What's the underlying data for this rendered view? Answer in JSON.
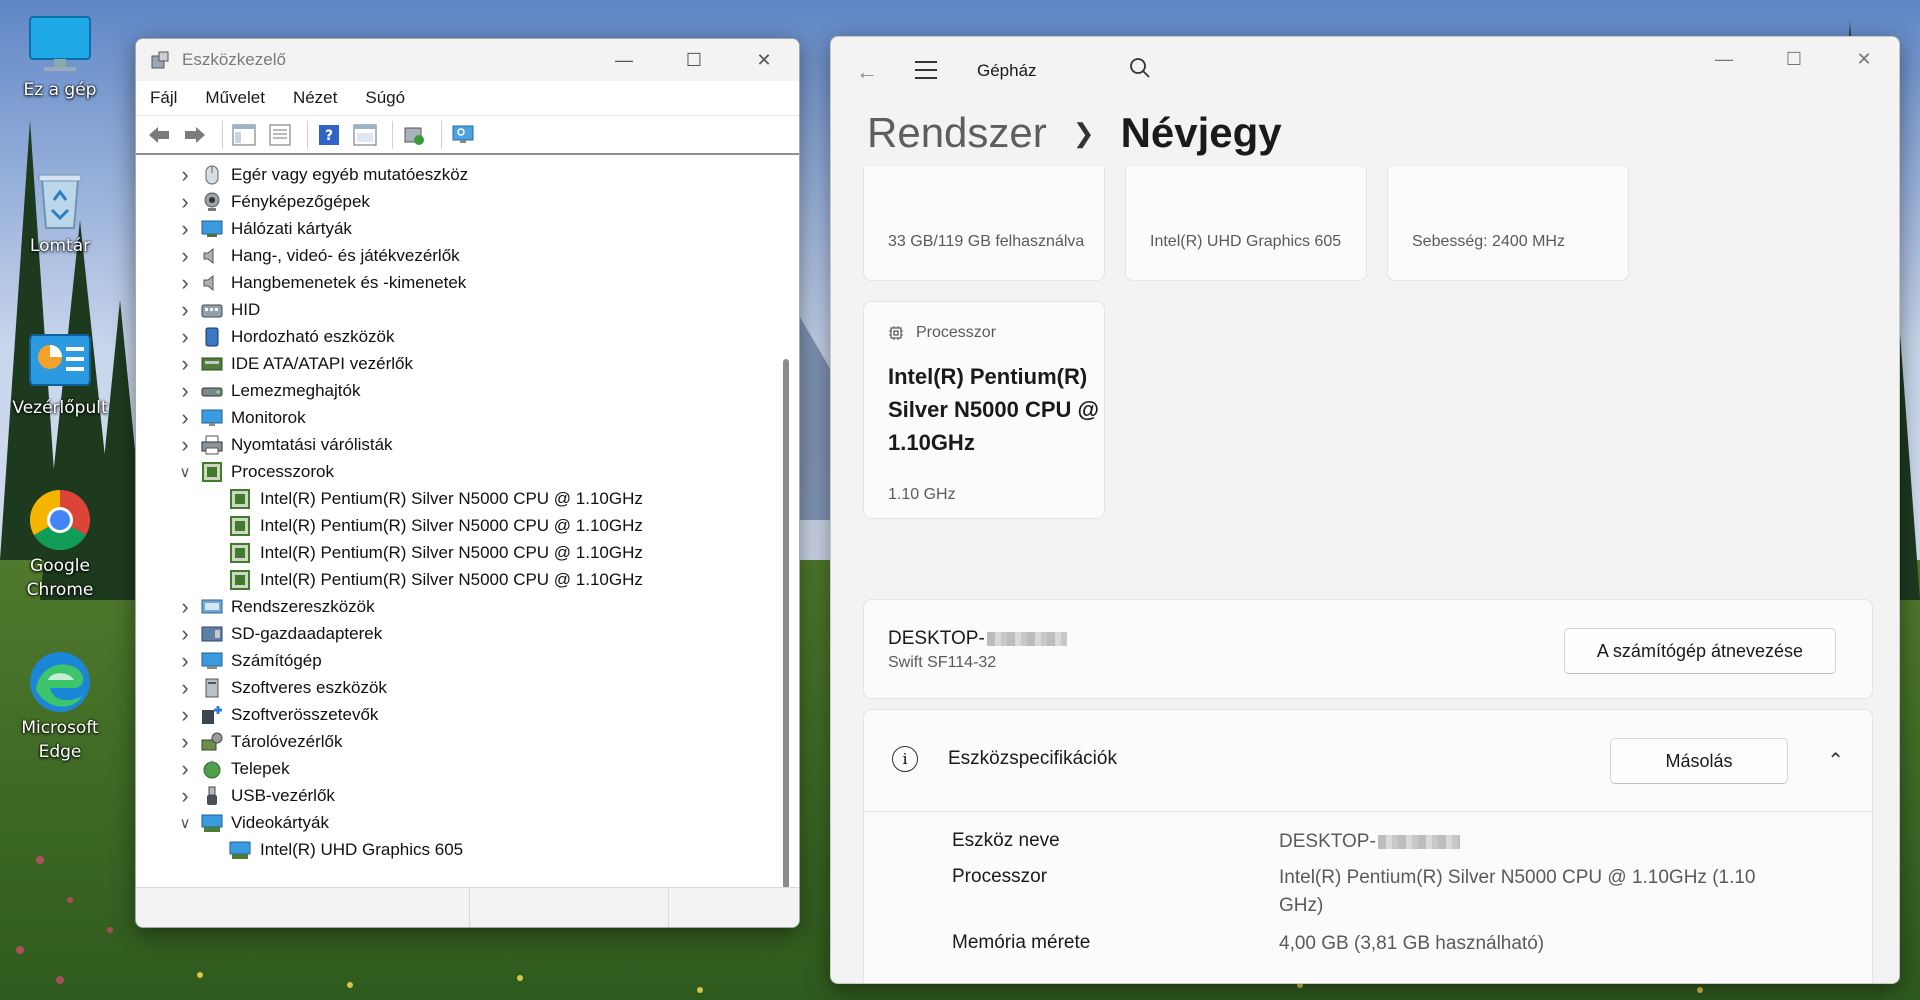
{
  "desktop": {
    "icons": [
      {
        "label": "Ez a gép",
        "icon": "monitor-icon"
      },
      {
        "label": "Lomtár",
        "icon": "recycle-bin-icon"
      },
      {
        "label": "Vezérlőpult",
        "icon": "control-panel-icon"
      },
      {
        "label": "Google Chrome",
        "icon": "chrome-icon"
      },
      {
        "label": "Microsoft Edge",
        "icon": "edge-icon"
      }
    ]
  },
  "device_manager": {
    "title": "Eszközkezelő",
    "menu": [
      "Fájl",
      "Művelet",
      "Nézet",
      "Súgó"
    ],
    "tree": [
      {
        "label": "Egér vagy egyéb mutatóeszköz",
        "icon": "mouse-icon",
        "expanded": false
      },
      {
        "label": "Fényképezőgépek",
        "icon": "camera-icon",
        "expanded": false
      },
      {
        "label": "Hálózati kártyák",
        "icon": "network-icon",
        "expanded": false
      },
      {
        "label": "Hang-, videó- és játékvezérlők",
        "icon": "speaker-icon",
        "expanded": false
      },
      {
        "label": "Hangbemenetek és -kimenetek",
        "icon": "speaker-icon",
        "expanded": false
      },
      {
        "label": "HID",
        "icon": "hid-icon",
        "expanded": false
      },
      {
        "label": "Hordozható eszközök",
        "icon": "portable-device-icon",
        "expanded": false
      },
      {
        "label": "IDE ATA/ATAPI vezérlők",
        "icon": "ide-controller-icon",
        "expanded": false
      },
      {
        "label": "Lemezmeghajtók",
        "icon": "disk-drive-icon",
        "expanded": false
      },
      {
        "label": "Monitorok",
        "icon": "monitor-icon",
        "expanded": false
      },
      {
        "label": "Nyomtatási várólisták",
        "icon": "printer-icon",
        "expanded": false
      },
      {
        "label": "Processzorok",
        "icon": "cpu-icon",
        "expanded": true,
        "children": [
          "Intel(R) Pentium(R) Silver N5000 CPU @ 1.10GHz",
          "Intel(R) Pentium(R) Silver N5000 CPU @ 1.10GHz",
          "Intel(R) Pentium(R) Silver N5000 CPU @ 1.10GHz",
          "Intel(R) Pentium(R) Silver N5000 CPU @ 1.10GHz"
        ]
      },
      {
        "label": "Rendszereszközök",
        "icon": "system-device-icon",
        "expanded": false
      },
      {
        "label": "SD-gazdaadapterek",
        "icon": "sd-adapter-icon",
        "expanded": false
      },
      {
        "label": "Számítógép",
        "icon": "computer-icon",
        "expanded": false
      },
      {
        "label": "Szoftveres eszközök",
        "icon": "software-device-icon",
        "expanded": false
      },
      {
        "label": "Szoftverösszetevők",
        "icon": "software-component-icon",
        "expanded": false
      },
      {
        "label": "Tárolóvezérlők",
        "icon": "storage-controller-icon",
        "expanded": false
      },
      {
        "label": "Telepek",
        "icon": "battery-icon",
        "expanded": false
      },
      {
        "label": "USB-vezérlők",
        "icon": "usb-icon",
        "expanded": false
      },
      {
        "label": "Videokártyák",
        "icon": "display-adapter-icon",
        "expanded": true,
        "children": [
          "Intel(R) UHD Graphics 605"
        ]
      }
    ]
  },
  "settings": {
    "app_title": "Gépház",
    "breadcrumb": {
      "parent": "Rendszer",
      "current": "Névjegy"
    },
    "top_cards": [
      "33 GB/119 GB felhasználva",
      "Intel(R) UHD Graphics 605",
      "Sebesség: 2400 MHz"
    ],
    "processor_card": {
      "heading": "Processzor",
      "name": "Intel(R) Pentium(R) Silver N5000 CPU @ 1.10GHz",
      "speed": "1.10 GHz"
    },
    "device_card": {
      "name_prefix": "DESKTOP-",
      "model": "Swift SF114-32",
      "rename_button": "A számítógép átnevezése"
    },
    "specs": {
      "title": "Eszközspecifikációk",
      "copy_button": "Másolás",
      "rows": [
        {
          "label": "Eszköz neve",
          "value": "DESKTOP-"
        },
        {
          "label": "Processzor",
          "value": "Intel(R) Pentium(R) Silver N5000 CPU @ 1.10GHz (1.10 GHz)"
        },
        {
          "label": "Memória mérete",
          "value": "4,00 GB (3,81 GB használható)"
        }
      ]
    }
  },
  "colors": {
    "accent": "#0067c0",
    "cpu_green": "#3f7d2c"
  }
}
